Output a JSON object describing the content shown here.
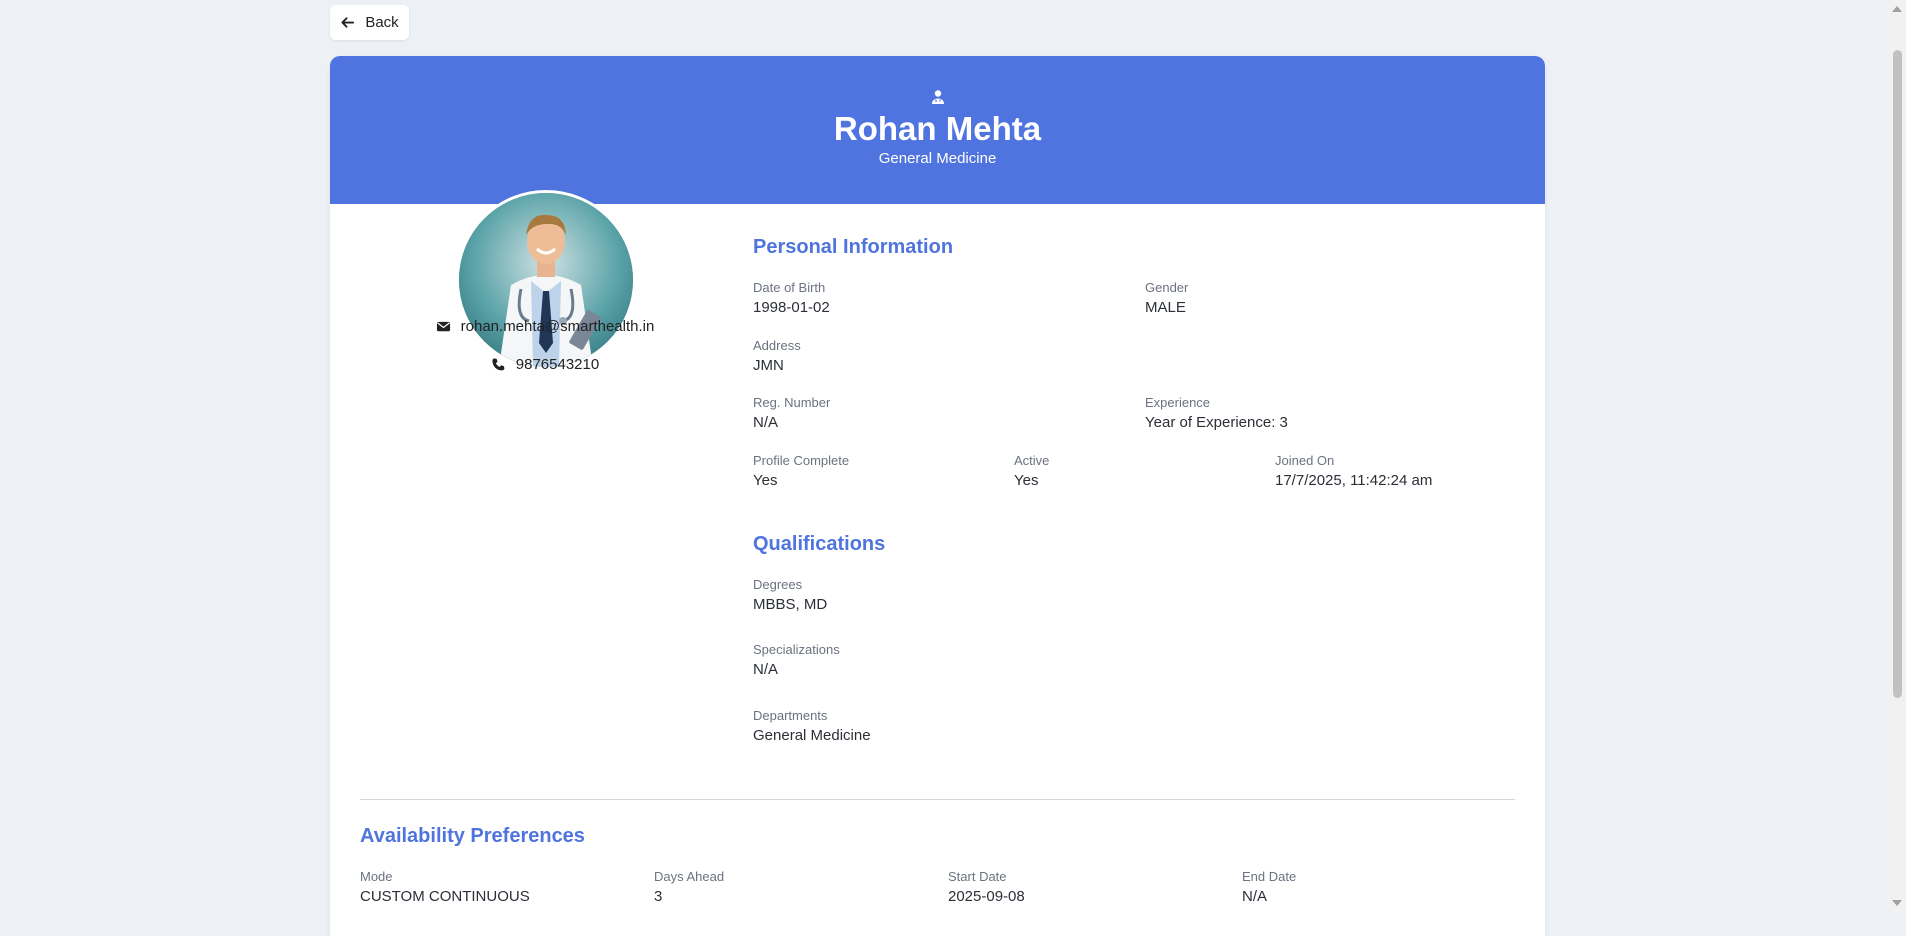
{
  "nav": {
    "back_label": "Back"
  },
  "doctor": {
    "name": "Rohan Mehta",
    "specialty": "General Medicine",
    "email": "rohan.mehta@smarthealth.in",
    "phone": "9876543210"
  },
  "personal": {
    "title": "Personal Information",
    "dob": {
      "label": "Date of Birth",
      "value": "1998-01-02"
    },
    "gender": {
      "label": "Gender",
      "value": "MALE"
    },
    "address": {
      "label": "Address",
      "value": "JMN"
    },
    "reg": {
      "label": "Reg. Number",
      "value": "N/A"
    },
    "experience": {
      "label": "Experience",
      "value": "Year of Experience: 3"
    },
    "profile_complete": {
      "label": "Profile Complete",
      "value": "Yes"
    },
    "active": {
      "label": "Active",
      "value": "Yes"
    },
    "joined": {
      "label": "Joined On",
      "value": "17/7/2025, 11:42:24 am"
    }
  },
  "qualifications": {
    "title": "Qualifications",
    "degrees": {
      "label": "Degrees",
      "value": "MBBS, MD"
    },
    "specializations": {
      "label": "Specializations",
      "value": "N/A"
    },
    "departments": {
      "label": "Departments",
      "value": "General Medicine"
    }
  },
  "availability": {
    "title": "Availability Preferences",
    "mode": {
      "label": "Mode",
      "value": "CUSTOM CONTINUOUS"
    },
    "days_ahead": {
      "label": "Days Ahead",
      "value": "3"
    },
    "start_date": {
      "label": "Start Date",
      "value": "2025-09-08"
    },
    "end_date": {
      "label": "End Date",
      "value": "N/A"
    }
  },
  "theme": {
    "accent": "#4f74df",
    "background": "#edf1f6"
  }
}
